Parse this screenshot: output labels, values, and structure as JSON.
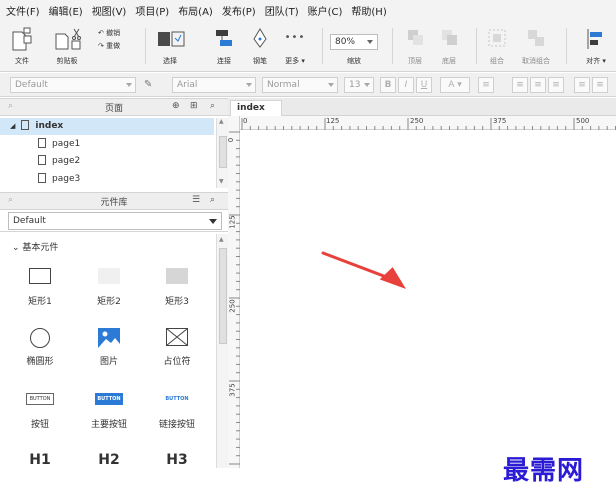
{
  "menu": [
    "文件(F)",
    "编辑(E)",
    "视图(V)",
    "项目(P)",
    "布局(A)",
    "发布(P)",
    "团队(T)",
    "账户(C)",
    "帮助(H)"
  ],
  "toolbar": {
    "file": "文件",
    "clipboard": "剪贴板",
    "undo": "撤销",
    "redo": "重做",
    "select": "选择",
    "connect": "连接",
    "pen": "钢笔",
    "more": "更多",
    "more_dots": "•••",
    "zoom_value": "80%",
    "zoom": "缩放",
    "top": "顶层",
    "bottom": "底层",
    "group": "组合",
    "ungroup": "取消组合",
    "align": "对齐"
  },
  "format": {
    "style": "Default",
    "font": "Arial",
    "weight": "Normal",
    "size": "13",
    "bold": "B",
    "italic": "I",
    "underline": "U",
    "color": "A"
  },
  "pages_panel": {
    "title": "页面",
    "items": [
      {
        "label": "index",
        "selected": true
      },
      {
        "label": "page1"
      },
      {
        "label": "page2"
      },
      {
        "label": "page3"
      }
    ]
  },
  "library_panel": {
    "title": "元件库",
    "selected": "Default",
    "group": "基本元件",
    "widgets": [
      {
        "label": "矩形1",
        "icon": "rect-outline-icon"
      },
      {
        "label": "矩形2",
        "icon": "rect-light-icon"
      },
      {
        "label": "矩形3",
        "icon": "rect-gray-icon"
      },
      {
        "label": "椭圆形",
        "icon": "circle-icon"
      },
      {
        "label": "图片",
        "icon": "image-icon"
      },
      {
        "label": "占位符",
        "icon": "placeholder-icon"
      },
      {
        "label": "按钮",
        "icon": "button-icon",
        "text": "BUTTON"
      },
      {
        "label": "主要按钮",
        "icon": "primary-button-icon",
        "text": "BUTTON"
      },
      {
        "label": "链接按钮",
        "icon": "link-button-icon",
        "text": "BUTTON"
      },
      {
        "label": "H1"
      },
      {
        "label": "H2"
      },
      {
        "label": "H3"
      }
    ]
  },
  "canvas": {
    "tab": "index",
    "tab_close": "×",
    "ruler_h": [
      "0",
      "125",
      "250",
      "375",
      "500"
    ],
    "ruler_v": [
      "0",
      "125",
      "250",
      "375"
    ]
  },
  "watermark": "最需网",
  "colors": {
    "accent": "#2b7bd6",
    "arrow": "#e8413b",
    "watermark": "#2b1bd4",
    "selection": "#d2e7f7"
  }
}
